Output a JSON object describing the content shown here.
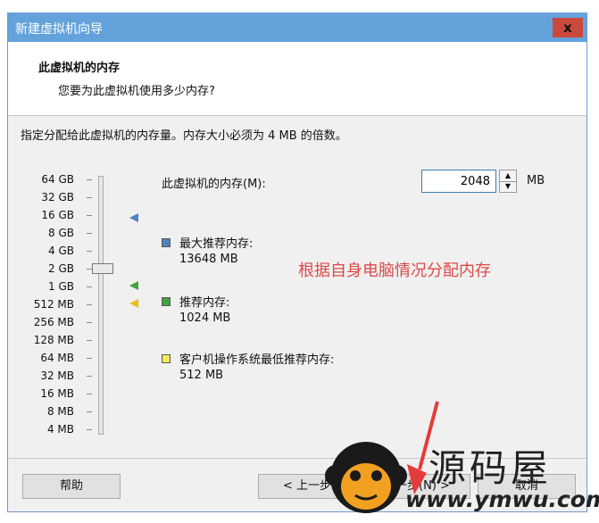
{
  "window": {
    "title": "新建虚拟机向导",
    "close_label": "x"
  },
  "header": {
    "title": "此虚拟机的内存",
    "subtitle": "您要为此虚拟机使用多少内存?"
  },
  "intro": "指定分配给此虚拟机的内存量。内存大小必须为 4 MB 的倍数。",
  "scale": [
    "64 GB",
    "32 GB",
    "16 GB",
    "8 GB",
    "4 GB",
    "2 GB",
    "1 GB",
    "512 MB",
    "256 MB",
    "128 MB",
    "64 MB",
    "32 MB",
    "16 MB",
    "8 MB",
    "4 MB"
  ],
  "memory": {
    "label": "此虚拟机的内存(M):",
    "value": "2048",
    "unit": "MB",
    "selected_scale": "2 GB"
  },
  "legend": [
    {
      "label": "最大推荐内存:",
      "value": "13648 MB",
      "color": "#4f81bd",
      "marker_at": "16 GB"
    },
    {
      "label": "推荐内存:",
      "value": "1024 MB",
      "color": "#41a33a",
      "marker_at": "1 GB"
    },
    {
      "label": "客户机操作系统最低推荐内存:",
      "value": "512 MB",
      "color": "#f5e85c",
      "marker_at": "512 MB"
    }
  ],
  "annotation": "根据自身电脑情况分配内存",
  "buttons": {
    "help": "帮助",
    "back": "< 上一步",
    "next": "下一步(N) >",
    "cancel": "取消"
  },
  "watermark": {
    "text": "源码屋",
    "url": "www.ymwu.com",
    "icon": "monkey-logo-icon"
  },
  "colors": {
    "title_bar": "#64a2dc",
    "annotation": "#dc4a4a",
    "input_border": "#3c7fb1"
  }
}
